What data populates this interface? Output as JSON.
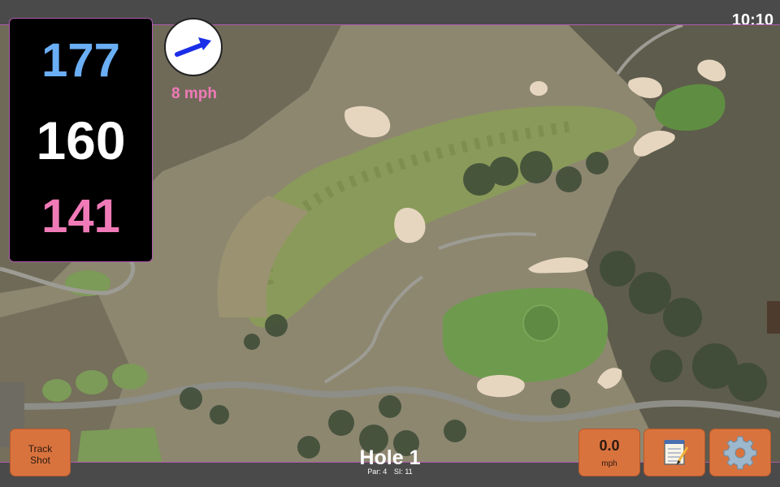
{
  "status_bar": {
    "clock": "10:10"
  },
  "distances": {
    "back": "177",
    "middle": "160",
    "front": "141"
  },
  "wind": {
    "speed": "8 mph",
    "icon": "wind-arrow-icon"
  },
  "hole": {
    "title": "Hole 1",
    "par": "Par: 4",
    "stroke_index": "SI: 11"
  },
  "buttons": {
    "track_shot_line1": "Track",
    "track_shot_line2": "Shot",
    "speed_value": "0.0",
    "speed_unit": "mph",
    "notes_icon": "notepad-icon",
    "settings_icon": "gear-icon"
  },
  "colors": {
    "back_distance": "#6aaef5",
    "middle_distance": "#ffffff",
    "front_distance": "#f07ab8",
    "button_orange": "#d9733e",
    "accent_border": "#b05ab0"
  }
}
